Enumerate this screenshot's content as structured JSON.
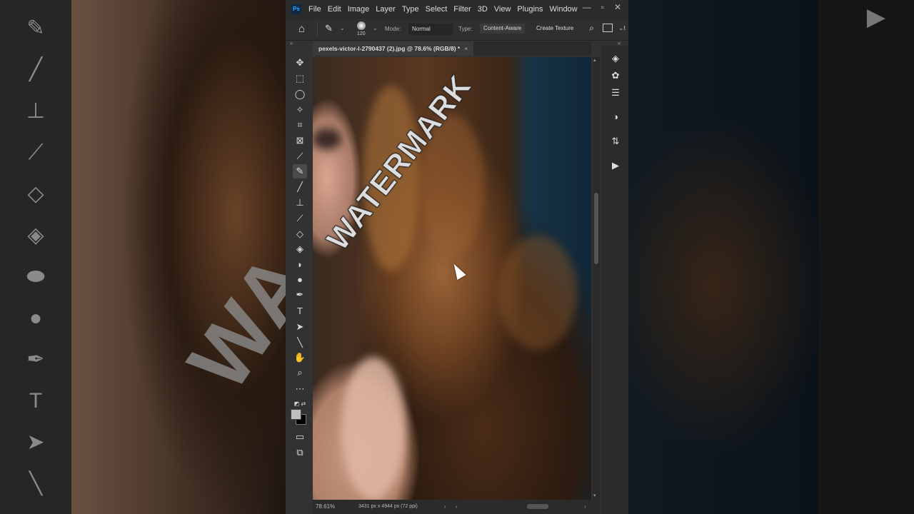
{
  "app": {
    "logo": "Ps",
    "menus": [
      "File",
      "Edit",
      "Image",
      "Layer",
      "Type",
      "Select",
      "Filter",
      "3D",
      "View",
      "Plugins",
      "Window"
    ]
  },
  "options": {
    "brush_size": "120",
    "mode_label": "Mode:",
    "mode_value": "Normal",
    "type_label": "Type:",
    "type_content_aware": "Content-Aware",
    "type_create_texture": "Create Texture"
  },
  "document": {
    "tab_title": "pexels-victor-l-2790437 (2).jpg @ 78.6% (RGB/8) *",
    "watermark_text": "WATERMARK"
  },
  "status": {
    "zoom": "78.61%",
    "doc_size": "3431 px x 4944 px (72 ppi)"
  },
  "background": {
    "watermark_fragment": "WA"
  },
  "colors": {
    "accent": "#31a8ff",
    "foreground_swatch": "#c0c0c0",
    "background_swatch": "#000000"
  }
}
